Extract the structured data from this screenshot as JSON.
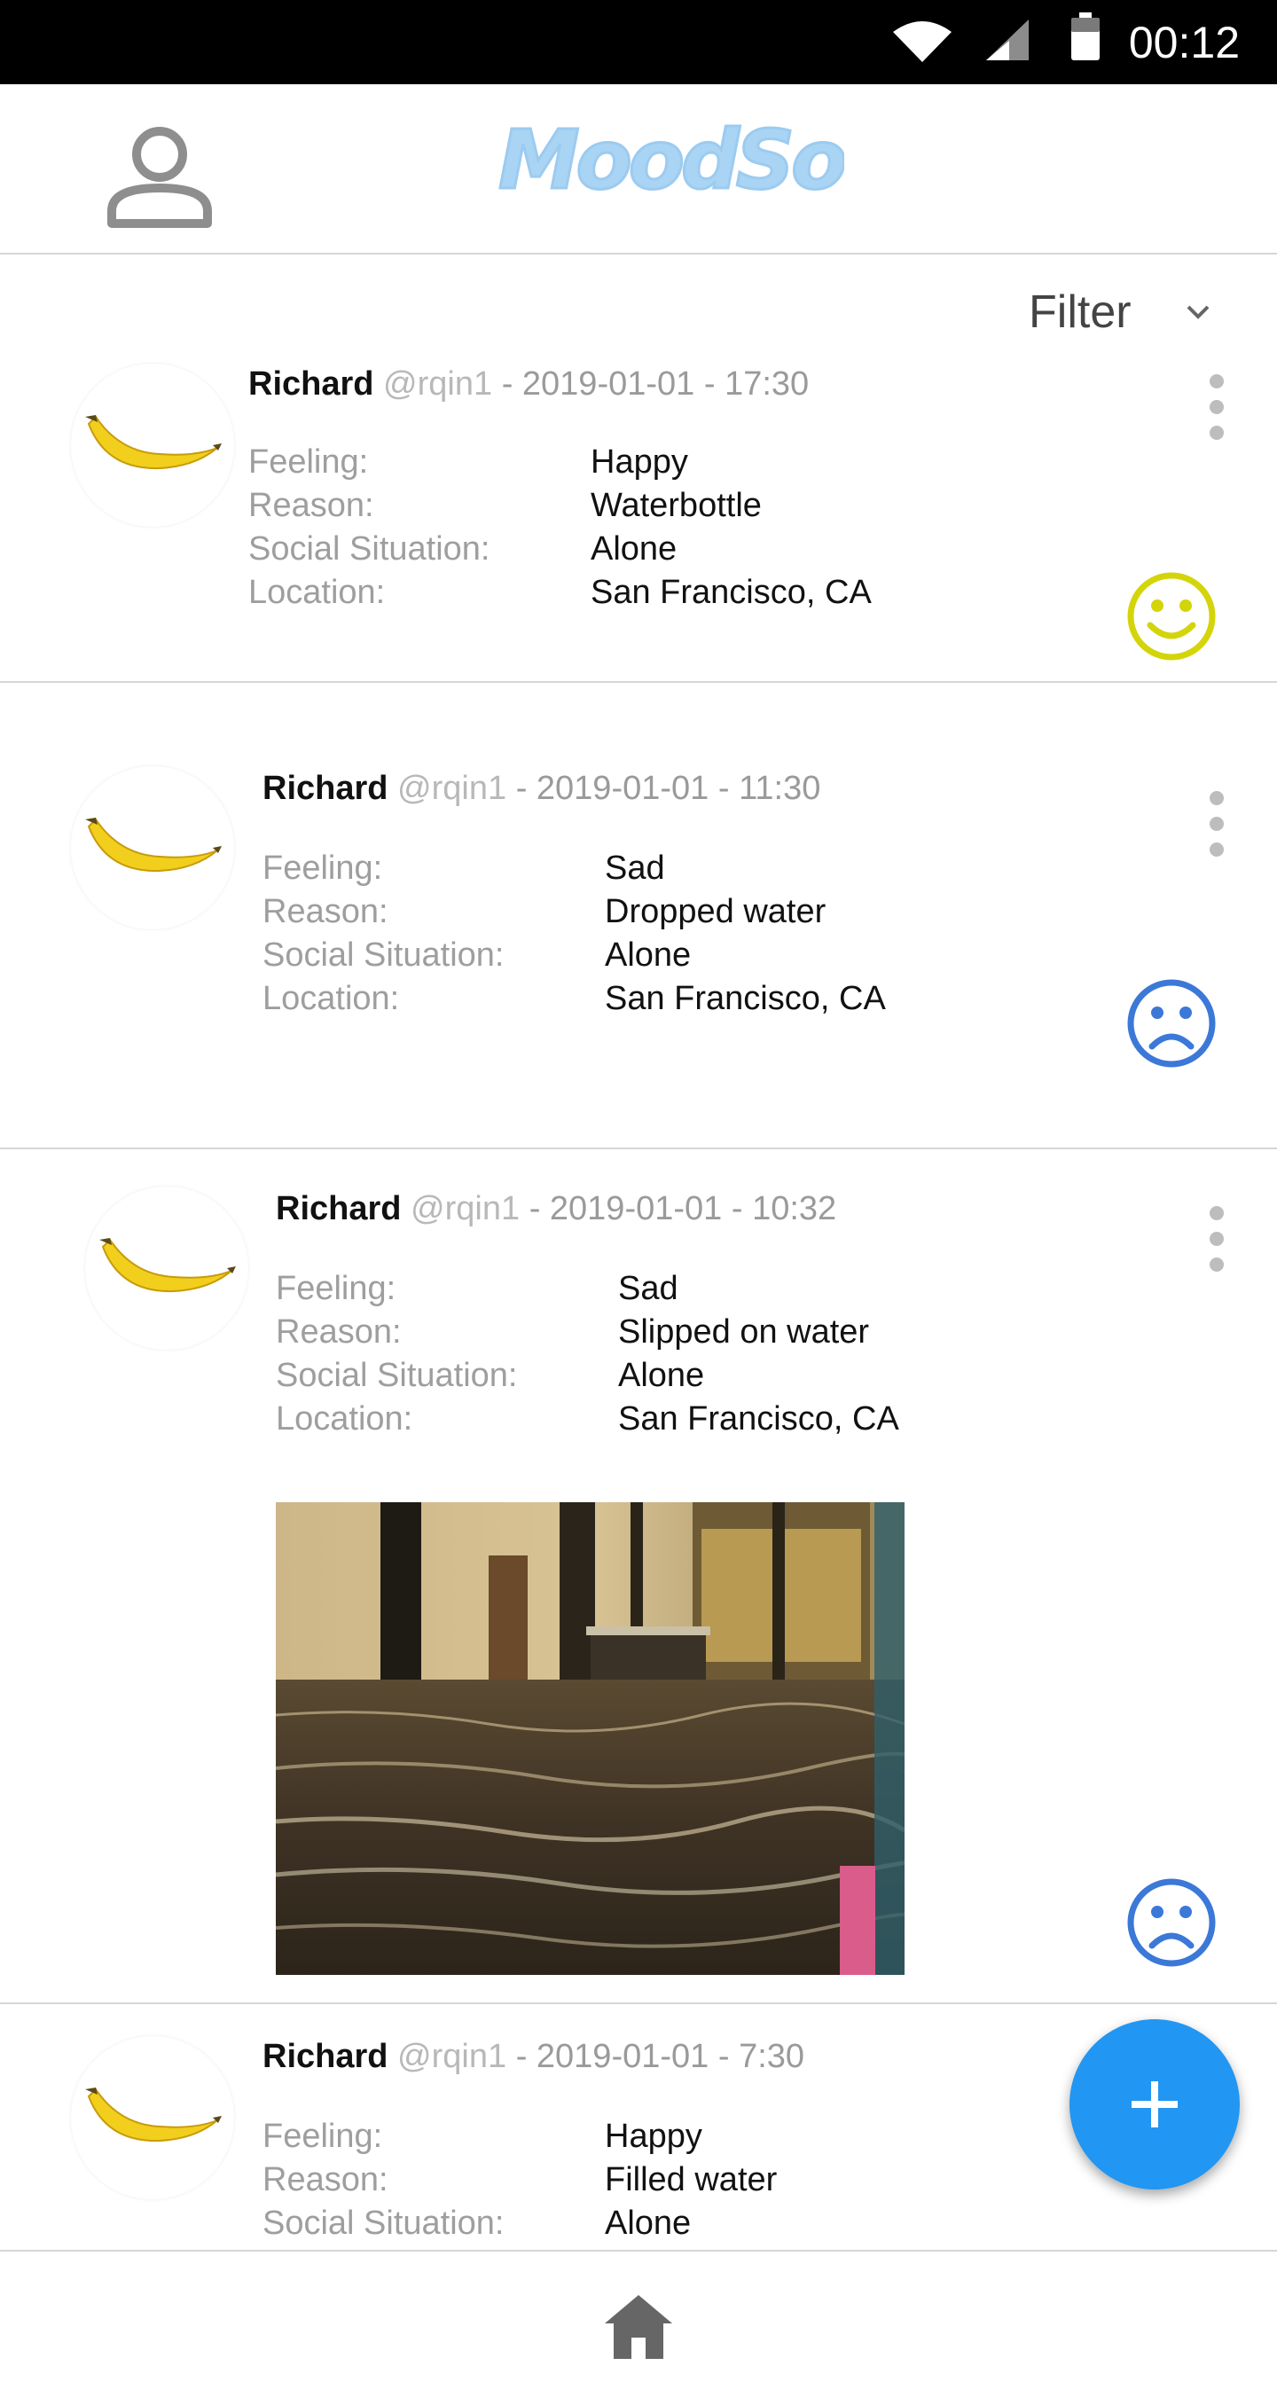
{
  "status_bar": {
    "time": "00:12",
    "icons": [
      "wifi-icon",
      "cell-signal-icon",
      "battery-icon"
    ]
  },
  "header": {
    "logo_text": "MoodSoup",
    "profile_icon": "person-icon",
    "logo_color": "#a9d4f4"
  },
  "filter": {
    "label": "Filter",
    "icon": "chevron-down-icon"
  },
  "labels": {
    "feeling": "Feeling:",
    "reason": "Reason:",
    "social": "Social Situation:",
    "location": "Location:",
    "sep": "-"
  },
  "posts": [
    {
      "name": "Richard",
      "handle": "@rqin1",
      "date": "2019-01-01",
      "time": "17:30",
      "feeling": "Happy",
      "reason": "Waterbottle",
      "social": "Alone",
      "location": "San Francisco, CA",
      "mood_icon": "happy-face-icon",
      "mood_color": "#d4d40a"
    },
    {
      "name": "Richard",
      "handle": "@rqin1",
      "date": "2019-01-01",
      "time": "11:30",
      "feeling": "Sad",
      "reason": "Dropped water",
      "social": "Alone",
      "location": "San Francisco, CA",
      "mood_icon": "sad-face-icon",
      "mood_color": "#3b78d8"
    },
    {
      "name": "Richard",
      "handle": "@rqin1",
      "date": "2019-01-01",
      "time": "10:32",
      "feeling": "Sad",
      "reason": "Slipped on water",
      "social": "Alone",
      "location": "San Francisco, CA",
      "mood_icon": "sad-face-icon",
      "mood_color": "#3b78d8",
      "photo": "flooded-lobby-photo"
    },
    {
      "name": "Richard",
      "handle": "@rqin1",
      "date": "2019-01-01",
      "time": "7:30",
      "feeling": "Happy",
      "reason": "Filled water",
      "social": "Alone"
    }
  ],
  "fab": {
    "icon": "plus-icon",
    "color": "#2196f3"
  },
  "bottom_nav": {
    "icon": "home-icon"
  }
}
